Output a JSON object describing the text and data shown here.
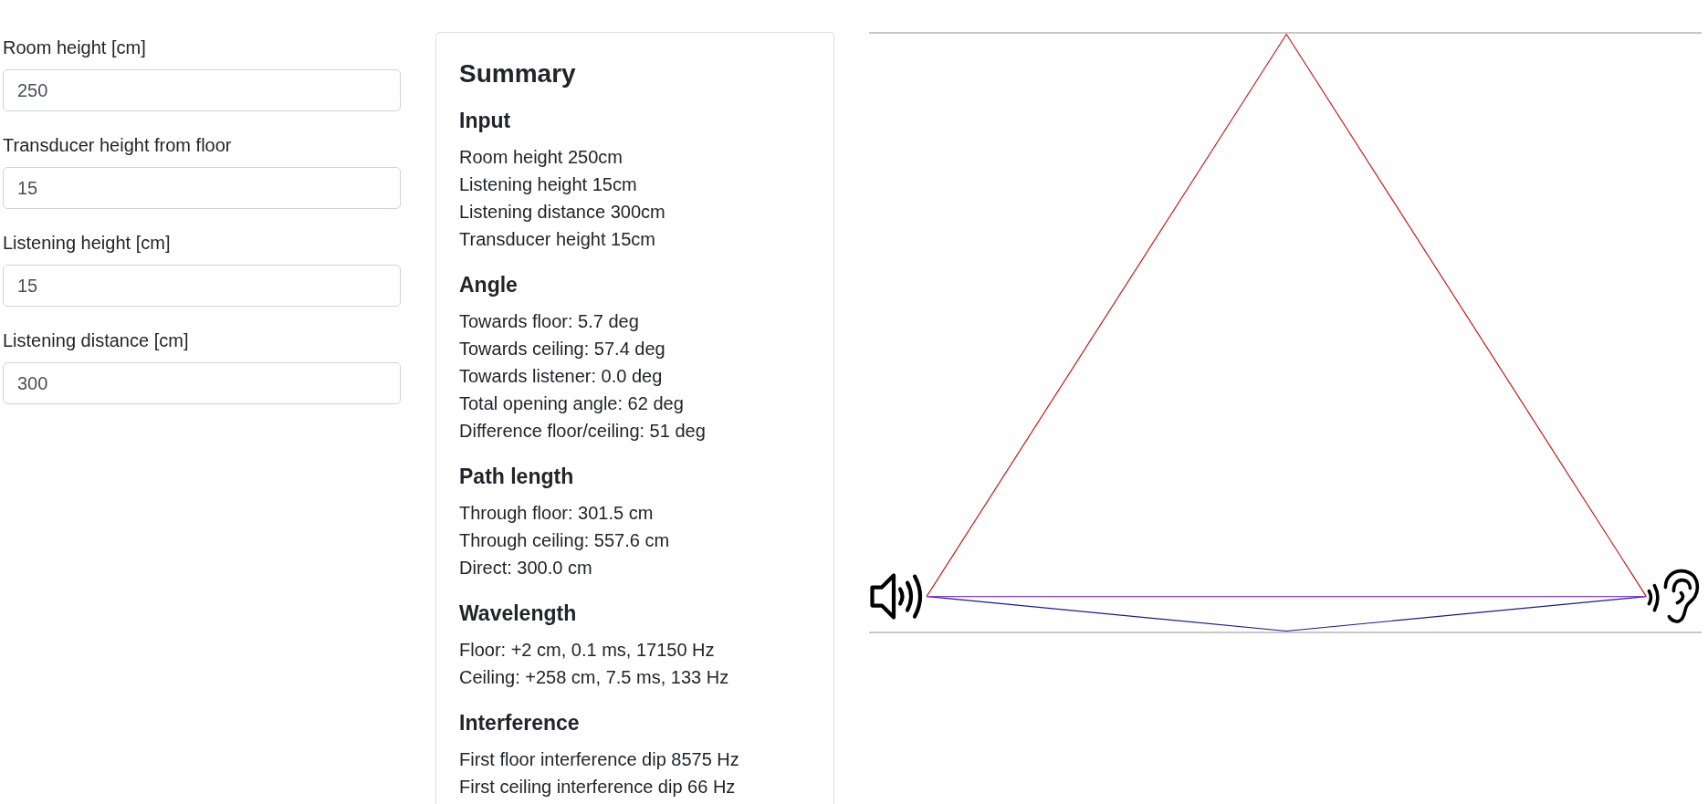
{
  "form": {
    "fields": [
      {
        "label": "Room height [cm]",
        "value": "250"
      },
      {
        "label": "Transducer height from floor",
        "value": "15"
      },
      {
        "label": "Listening height [cm]",
        "value": "15"
      },
      {
        "label": "Listening distance [cm]",
        "value": "300"
      }
    ]
  },
  "summary": {
    "title": "Summary",
    "sections": [
      {
        "heading": "Input",
        "lines": [
          "Room height 250cm",
          "Listening height 15cm",
          "Listening distance 300cm",
          "Transducer height 15cm"
        ]
      },
      {
        "heading": "Angle",
        "lines": [
          "Towards floor: 5.7 deg",
          "Towards ceiling: 57.4 deg",
          "Towards listener: 0.0 deg",
          "Total opening angle: 62 deg",
          "Difference floor/ceiling: 51 deg"
        ]
      },
      {
        "heading": "Path length",
        "lines": [
          "Through floor: 301.5 cm",
          "Through ceiling: 557.6 cm",
          "Direct: 300.0 cm"
        ]
      },
      {
        "heading": "Wavelength",
        "lines": [
          "Floor: +2 cm, 0.1 ms, 17150 Hz",
          "Ceiling: +258 cm, 7.5 ms, 133 Hz"
        ]
      },
      {
        "heading": "Interference",
        "lines": [
          "First floor interference dip 8575 Hz",
          "First ceiling interference dip 66 Hz"
        ]
      }
    ]
  }
}
